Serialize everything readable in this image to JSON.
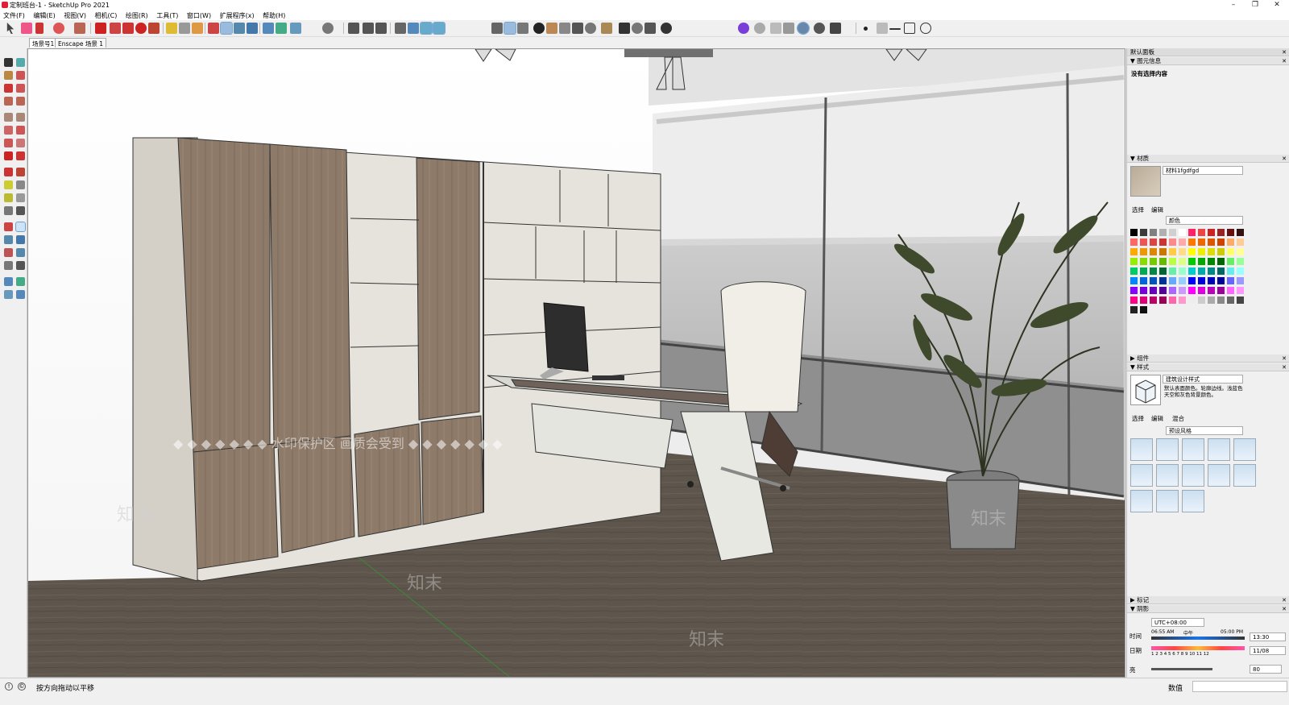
{
  "window": {
    "title": "定制班台-1 - SketchUp Pro 2021",
    "controls": [
      "–",
      "❐",
      "✕"
    ]
  },
  "menu": [
    "文件(F)",
    "编辑(E)",
    "视图(V)",
    "相机(C)",
    "绘图(R)",
    "工具(T)",
    "窗口(W)",
    "扩展程序(x)",
    "帮助(H)"
  ],
  "scene_tabs": [
    "场景号1",
    "Enscape 场景 1"
  ],
  "viewport": {
    "watermark_text": "◆ ◆ ◆ ◆ ◆ ◆ ◆ 水印保护区 画质会受到 ◆ ◆ ◆ ◆ ◆ ◆ ◆",
    "watermark_logo": "知末"
  },
  "panel": {
    "header": "默认面板",
    "entity_info": {
      "title": "图元信息",
      "status": "没有选择内容"
    },
    "materials": {
      "title": "材质",
      "material_name": "材料1fgdfgd",
      "tabs": [
        "选择",
        "编辑"
      ],
      "library": "颜色"
    },
    "components": {
      "title": "组件"
    },
    "styles": {
      "title": "样式",
      "style_name": "建筑设计样式",
      "description": "默认表面颜色。轮廓边线。浅蓝色天空和灰色背景颜色。",
      "tabs": [
        "选择",
        "编辑",
        "混合"
      ],
      "library": "预设风格"
    },
    "tags": {
      "title": "标记"
    },
    "shadows": {
      "title": "阴影",
      "timezone": "UTC+08:00",
      "time_label": "时间",
      "time_start": "06:55 AM",
      "time_mid": "中午",
      "time_end": "05:00 PM",
      "time_value": "13:30",
      "date_label": "日期",
      "months": "1 2 3 4 5 6 7 8 9 10 11 12",
      "date_value": "11/08",
      "light_label": "亮",
      "light_value": "80"
    }
  },
  "statusbar": {
    "message": "按方向拖动以平移",
    "measurement_label": "数值"
  },
  "colors": {
    "floor": "#5f564d",
    "cabinet_wood": "#8e7b6b",
    "cabinet_frame": "#e6e3dc",
    "accent_blue": "#1a73e8"
  }
}
